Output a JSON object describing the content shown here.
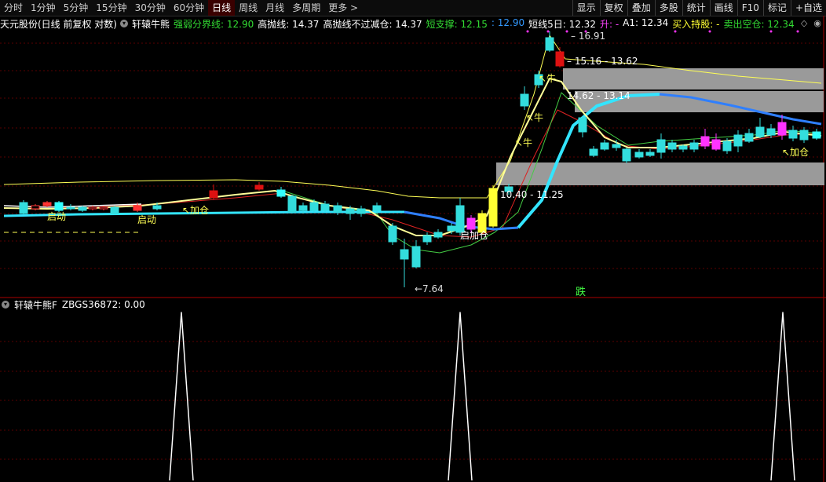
{
  "toolbar": {
    "tabs": [
      "分时",
      "1分钟",
      "5分钟",
      "15分钟",
      "30分钟",
      "60分钟",
      "日线",
      "周线",
      "月线",
      "多周期",
      "更多 >"
    ],
    "active_tab": "日线",
    "tools": [
      "显示",
      "复权",
      "叠加",
      "多股",
      "统计",
      "画线",
      "F10",
      "标记",
      "+自选"
    ]
  },
  "info": {
    "stock": "天元股份(日线 前复权 对数)",
    "indicator": "轩辕牛熊",
    "items": [
      {
        "label": "强弱分界线: 12.90",
        "color": "#33dd33"
      },
      {
        "label": "高抛线: 14.37",
        "color": "#ffffff"
      },
      {
        "label": "高抛线不过减仓: 14.37",
        "color": "#ffffff"
      },
      {
        "label": "短支撑: 12.15",
        "color": "#33dd33"
      },
      {
        "label": ": 12.90",
        "color": "#3399ff"
      },
      {
        "label": "短线5日: 12.32",
        "color": "#ffffff"
      },
      {
        "label": "升: -",
        "color": "#ff44ff"
      },
      {
        "label": "A1: 12.34",
        "color": "#ffffff"
      },
      {
        "label": "买入持股: -",
        "color": "#ffff33"
      },
      {
        "label": "卖出空仓: 12.34",
        "color": "#33dd33"
      }
    ]
  },
  "sub_info": {
    "indicator": "轩辕牛熊F",
    "value": "ZBGS36872: 0.00"
  },
  "annotations": {
    "high": "16.91",
    "low": "7.64",
    "zone_top": "15.16 - 13.62",
    "zone_mid": "14.62 - 13.14",
    "zone_low": "10.40 - 11.25",
    "qidong": "启动",
    "jiacang": "加仓",
    "qijiacang": "启加仓",
    "niu": "牛",
    "die": "跌",
    "chevron": "▾"
  },
  "colors": {
    "up": "#ff3333",
    "down": "#33dddd",
    "yellow": "#ffff55",
    "cyan": "#33e5ff",
    "blue": "#2f7fff",
    "green": "#44cc44",
    "red": "#dd2222",
    "grid": "#5a0000",
    "zone": "#9a9a9a"
  }
}
